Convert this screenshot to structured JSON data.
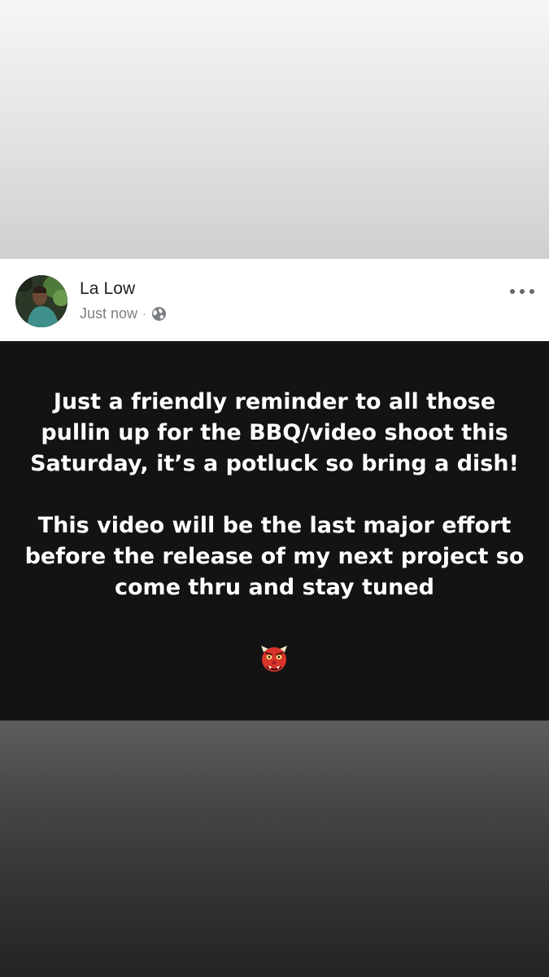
{
  "post": {
    "author": "La Low",
    "timestamp": "Just now",
    "separator": "·",
    "privacy_icon": "globe-icon",
    "more_icon": "more-options-icon",
    "body_paragraphs": [
      "Just a friendly reminder to all those pullin up for the BBQ/video shoot this Saturday, it’s a potluck so bring a dish!",
      "This video will be the last major effort before the release of my next project so come thru and stay tuned"
    ],
    "emoji": "ogre-emoji-icon"
  },
  "colors": {
    "post_background": "#131313",
    "post_text": "#ffffff",
    "name_text": "#1c1e21",
    "meta_text": "#7b7e83",
    "emoji_red": "#d9342b"
  }
}
